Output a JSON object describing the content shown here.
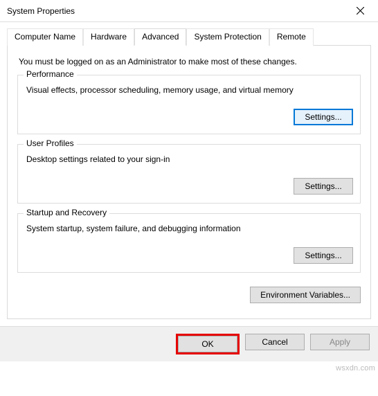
{
  "window": {
    "title": "System Properties"
  },
  "tabs": {
    "computer_name": "Computer Name",
    "hardware": "Hardware",
    "advanced": "Advanced",
    "system_protection": "System Protection",
    "remote": "Remote"
  },
  "advanced": {
    "intro": "You must be logged on as an Administrator to make most of these changes.",
    "performance": {
      "legend": "Performance",
      "desc": "Visual effects, processor scheduling, memory usage, and virtual memory",
      "settings_label": "Settings..."
    },
    "user_profiles": {
      "legend": "User Profiles",
      "desc": "Desktop settings related to your sign-in",
      "settings_label": "Settings..."
    },
    "startup": {
      "legend": "Startup and Recovery",
      "desc": "System startup, system failure, and debugging information",
      "settings_label": "Settings..."
    },
    "env_label": "Environment Variables..."
  },
  "buttons": {
    "ok": "OK",
    "cancel": "Cancel",
    "apply": "Apply"
  },
  "watermark": "wsxdn.com"
}
